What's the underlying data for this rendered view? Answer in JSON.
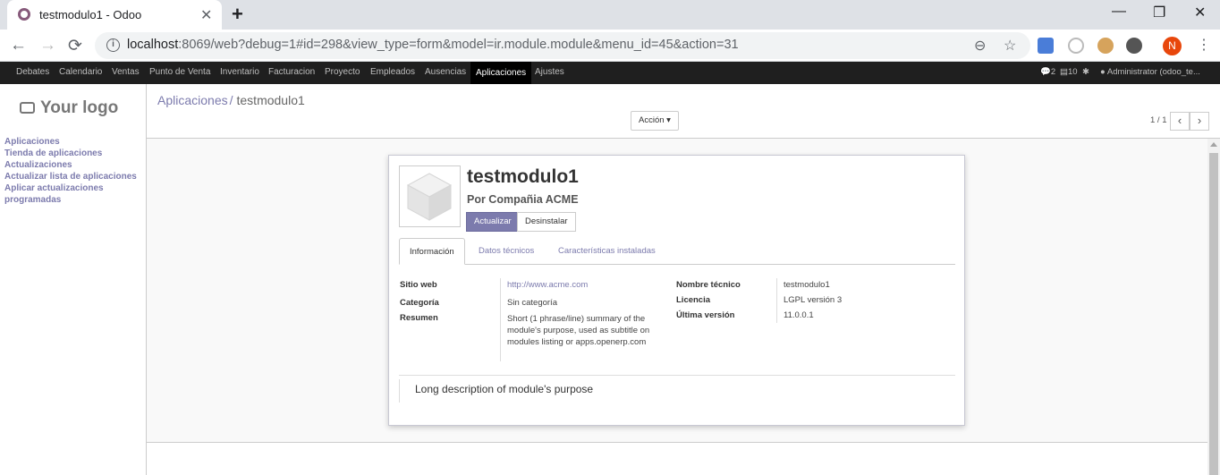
{
  "browser": {
    "tab_title": "testmodulo1 - Odoo",
    "tab_close": "✕",
    "new_tab": "+",
    "url_host": "localhost",
    "url_rest": ":8069/web?debug=1#id=298&view_type=form&model=ir.module.module&menu_id=45&action=31",
    "back": "←",
    "forward": "→",
    "reload": "⟳",
    "zoom_icon": "⊖",
    "star_icon": "☆",
    "profile_letter": "N",
    "menu_dots": "⋮",
    "minimize": "—",
    "restore": "❐",
    "close": "✕"
  },
  "topnav": {
    "items": [
      "Debates",
      "Calendario",
      "Ventas",
      "Punto de Venta",
      "Inventario",
      "Facturacion",
      "Proyecto",
      "Empleados",
      "Ausencias",
      "Aplicaciones",
      "Ajustes"
    ],
    "active": "Aplicaciones",
    "messages_count": "2",
    "activities_count": "10",
    "user": "Administrator (odoo_te..."
  },
  "sidebar": {
    "logo_text": "Your logo",
    "links": [
      "Aplicaciones",
      "Tienda de aplicaciones",
      "Actualizaciones",
      "Actualizar lista de aplicaciones",
      "Aplicar actualizaciones programadas"
    ]
  },
  "control": {
    "breadcrumb_parent": "Aplicaciones",
    "breadcrumb_sep": "/",
    "breadcrumb_current": "testmodulo1",
    "action_label": "Acción ▾",
    "pager": "1 / 1",
    "prev": "‹",
    "next": "›"
  },
  "form": {
    "title": "testmodulo1",
    "author": "Por Compañia ACME",
    "update_label": "Actualizar",
    "uninstall_label": "Desinstalar",
    "tabs": [
      "Información",
      "Datos técnicos",
      "Características instaladas"
    ],
    "active_tab": "Información",
    "fields_left": [
      {
        "label": "Sitio web",
        "value": "http://www.acme.com"
      },
      {
        "label": "Categoría",
        "value": "Sin categoría"
      },
      {
        "label": "Resumen",
        "value": "Short (1 phrase/line) summary of the module's purpose, used as subtitle on modules listing or apps.openerp.com"
      }
    ],
    "fields_right": [
      {
        "label": "Nombre técnico",
        "value": "testmodulo1"
      },
      {
        "label": "Licencia",
        "value": "LGPL versión 3"
      },
      {
        "label": "Última versión",
        "value": "11.0.0.1"
      }
    ],
    "description": "Long description of module's purpose"
  },
  "colors": {
    "brand": "#875a7b",
    "accent": "#7c7bad",
    "navbar": "#1f1f1f"
  }
}
